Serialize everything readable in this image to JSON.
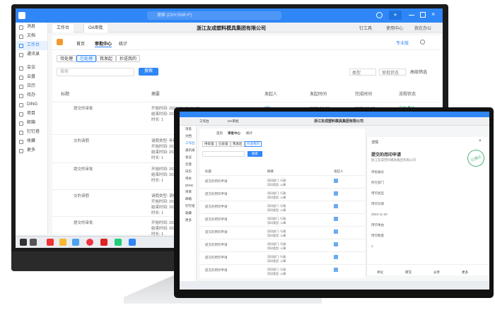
{
  "big": {
    "search_placeholder": "搜索 (Ctrl+Shift+F)",
    "top_right": [
      "钉工具",
      "使用中心",
      "我在办公"
    ],
    "company": "浙江友成塑料模具集团有限公司",
    "tabs": [
      "工作台",
      "OA审批"
    ],
    "nav": [
      "消息",
      "文档",
      "工作台",
      "通讯录",
      "会议",
      "云盘",
      "日历",
      "待办",
      "DING",
      "项目",
      "邮箱",
      "钉钉搭",
      "收藏",
      "更多"
    ],
    "subtabs": [
      "首页",
      "审批中心",
      "统计"
    ],
    "pro_label": "专业版",
    "filters": [
      "待处理",
      "已处理",
      "我发起",
      "抄送我的"
    ],
    "search_box": "搜索",
    "search_btn": "搜索",
    "dropdowns": [
      "类型",
      "审批状态",
      "高级筛选"
    ],
    "columns": [
      "标题",
      "摘要",
      "发起人",
      "发起时间",
      "完成时间",
      "流程状态"
    ],
    "rows": [
      {
        "title": "提交的审批",
        "summary": [
          "开始时间: 2022-12-07 16:03",
          "结束时间: 2022-12-07",
          "时长: 1"
        ],
        "start": "2022-12-08",
        "end": "2022-12-08",
        "status": "审批通过"
      },
      {
        "title": "交的请假",
        "summary": [
          "请假类型: 年假",
          "开始时间: 2022-12-07",
          "结束时间: 2022-12-07",
          "时长: 1"
        ],
        "start": "",
        "end": "",
        "status": ""
      },
      {
        "title": "提交的审批",
        "summary": [
          "开始时间: 2022-12-06",
          "结束时间: 2022-12-06",
          "时长: 1"
        ],
        "start": "",
        "end": "",
        "status": ""
      },
      {
        "title": "交的请假",
        "summary": [
          "请假类型: 调休",
          "开始时间: 2022-12-05",
          "结束时间: 2022-12-05",
          "时长: 1"
        ],
        "start": "",
        "end": "",
        "status": ""
      },
      {
        "title": "提交的审批",
        "summary": [
          "开始时间: 2022-11-02",
          "结束时间: 2022-11-02",
          "时长: 1"
        ],
        "start": "",
        "end": "",
        "status": ""
      }
    ]
  },
  "small": {
    "company": "浙江友成塑料模具集团有限公司",
    "tabs": [
      "工作台",
      "OA审批"
    ],
    "subtabs": [
      "首页",
      "审批中心",
      "统计"
    ],
    "filters": [
      "待处理",
      "已处理",
      "我发起",
      "抄送我的"
    ],
    "search_btn": "搜索",
    "columns": [
      "标题",
      "摘要",
      "发起人"
    ],
    "row_title": "提交的用印申请",
    "row_summary": [
      "用印部门: 行政",
      "用印类型: 公章"
    ],
    "detail_title": "详情",
    "detail_heading": "提交的用印申请",
    "detail_org": "浙江友成塑料模具集团有限公司",
    "detail_fields": [
      "审批编号",
      "所在部门",
      "用印类型",
      "用印日期",
      "2022-11-20",
      "用印事由",
      "用印数量",
      "1"
    ],
    "stamp": "已通过",
    "bottom_actions": [
      "评论",
      "转交",
      "分享",
      "更多"
    ]
  }
}
